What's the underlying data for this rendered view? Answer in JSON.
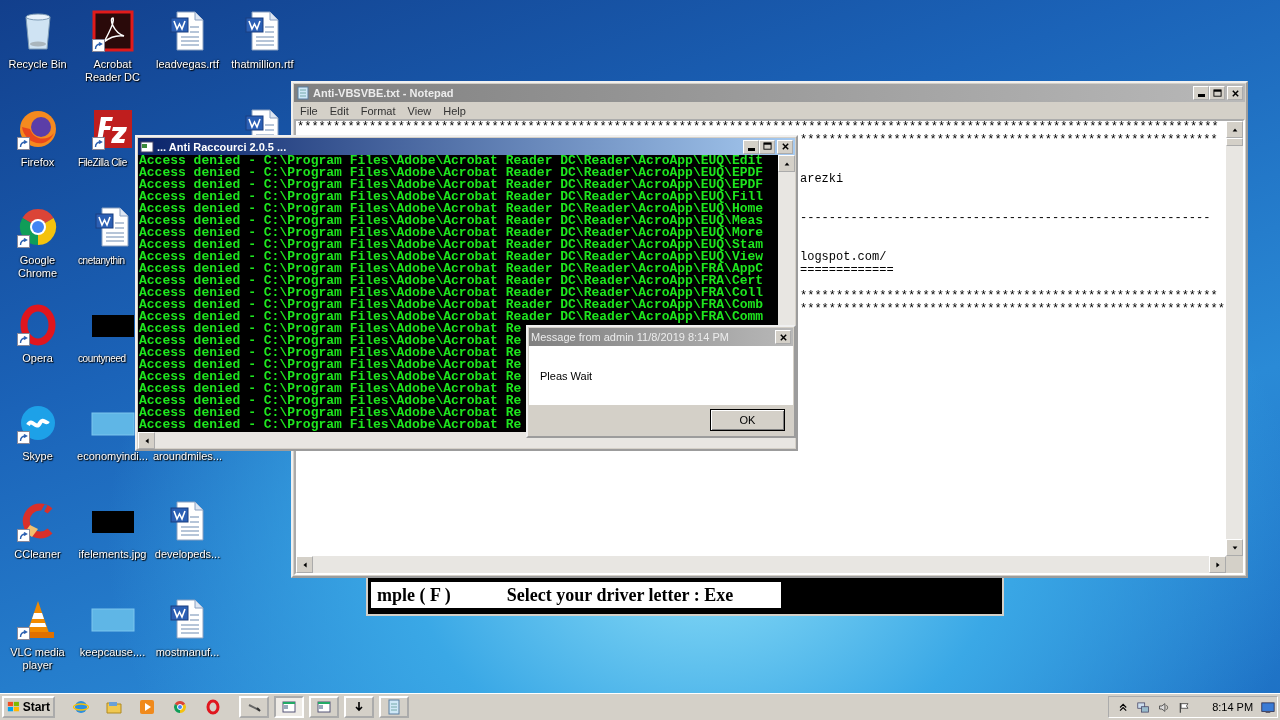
{
  "desktop_icons": [
    {
      "label": "Recycle Bin",
      "kind": "recycle"
    },
    {
      "label": "Firefox",
      "kind": "firefox"
    },
    {
      "label": "Google Chrome",
      "kind": "chrome"
    },
    {
      "label": "Opera",
      "kind": "opera"
    },
    {
      "label": "Skype",
      "kind": "skype"
    },
    {
      "label": "CCleaner",
      "kind": "ccleaner"
    },
    {
      "label": "VLC media player",
      "kind": "vlc"
    },
    {
      "label": "Acrobat Reader DC",
      "kind": "acrobat"
    },
    {
      "label": "FileZilla Clie",
      "kind": "filezilla"
    },
    {
      "label": "cnetanythin",
      "kind": "word"
    },
    {
      "label": "countyneed",
      "kind": "dark-thumb"
    },
    {
      "label": "economyindi...",
      "kind": "blank-thumb"
    },
    {
      "label": "ifelements.jpg",
      "kind": "dark-thumb"
    },
    {
      "label": "keepcause....",
      "kind": "blank-thumb"
    },
    {
      "label": "leadvegas.rtf",
      "kind": "word"
    },
    {
      "label": "aroundmiles...",
      "kind": "none"
    },
    {
      "label": "developeds...",
      "kind": "word"
    },
    {
      "label": "mostmanuf...",
      "kind": "word"
    },
    {
      "label": "thatmillion.rtf",
      "kind": "word"
    },
    {
      "kind": "word"
    }
  ],
  "notepad": {
    "title": "Anti-VBSVBE.txt - Notepad",
    "menu": [
      "File",
      "Edit",
      "Format",
      "View",
      "Help"
    ],
    "lines": [
      {
        "kind": "full",
        "text": "********************************************************************************************************************************"
      },
      {
        "kind": "partial",
        "text": "**********************************************************"
      },
      {
        "kind": "partial",
        "text": "arezki"
      },
      {
        "kind": "partial",
        "text": "---------------------------------------------------------"
      },
      {
        "kind": "partial",
        "text": "logspot.com/"
      },
      {
        "kind": "partial",
        "text": "============="
      },
      {
        "kind": "partial",
        "text": "**********************************************************"
      },
      {
        "kind": "partial",
        "text": "***********************************************************"
      }
    ]
  },
  "console": {
    "title": "... Anti Raccourci 2.0.5 ...",
    "lines": [
      "Access denied - C:\\Program Files\\Adobe\\Acrobat Reader DC\\Reader\\AcroApp\\EUQ\\Edit",
      "Access denied - C:\\Program Files\\Adobe\\Acrobat Reader DC\\Reader\\AcroApp\\EUQ\\EPDF",
      "Access denied - C:\\Program Files\\Adobe\\Acrobat Reader DC\\Reader\\AcroApp\\EUQ\\EPDF",
      "Access denied - C:\\Program Files\\Adobe\\Acrobat Reader DC\\Reader\\AcroApp\\EUQ\\Fill",
      "Access denied - C:\\Program Files\\Adobe\\Acrobat Reader DC\\Reader\\AcroApp\\EUQ\\Home",
      "Access denied - C:\\Program Files\\Adobe\\Acrobat Reader DC\\Reader\\AcroApp\\EUQ\\Meas",
      "Access denied - C:\\Program Files\\Adobe\\Acrobat Reader DC\\Reader\\AcroApp\\EUQ\\More",
      "Access denied - C:\\Program Files\\Adobe\\Acrobat Reader DC\\Reader\\AcroApp\\EUQ\\Stam",
      "Access denied - C:\\Program Files\\Adobe\\Acrobat Reader DC\\Reader\\AcroApp\\EUQ\\View",
      "Access denied - C:\\Program Files\\Adobe\\Acrobat Reader DC\\Reader\\AcroApp\\FRA\\AppC",
      "Access denied - C:\\Program Files\\Adobe\\Acrobat Reader DC\\Reader\\AcroApp\\FRA\\Cert",
      "Access denied - C:\\Program Files\\Adobe\\Acrobat Reader DC\\Reader\\AcroApp\\FRA\\Coll",
      "Access denied - C:\\Program Files\\Adobe\\Acrobat Reader DC\\Reader\\AcroApp\\FRA\\Comb",
      "Access denied - C:\\Program Files\\Adobe\\Acrobat Reader DC\\Reader\\AcroApp\\FRA\\Comm",
      "Access denied - C:\\Program Files\\Adobe\\Acrobat Re",
      "Access denied - C:\\Program Files\\Adobe\\Acrobat Re",
      "Access denied - C:\\Program Files\\Adobe\\Acrobat Re",
      "Access denied - C:\\Program Files\\Adobe\\Acrobat Re",
      "Access denied - C:\\Program Files\\Adobe\\Acrobat Re",
      "Access denied - C:\\Program Files\\Adobe\\Acrobat Re",
      "Access denied - C:\\Program Files\\Adobe\\Acrobat Re",
      "Access denied - C:\\Program Files\\Adobe\\Acrobat Re",
      "Access denied - C:\\Program Files\\Adobe\\Acrobat Re"
    ]
  },
  "message_box": {
    "title": "Message from admin 11/8/2019 8:14 PM",
    "message": "Pleas Wait",
    "button": "OK"
  },
  "driver_window": {
    "texts": [
      "mple ( F )",
      "Select your driver letter : Exe"
    ]
  },
  "taskbar": {
    "start": "Start",
    "quick_launch": [
      {
        "kind": "ie"
      },
      {
        "kind": "folder"
      },
      {
        "kind": "media"
      },
      {
        "kind": "chrome"
      },
      {
        "kind": "opera"
      }
    ],
    "tasks": [
      {
        "kind": "tool",
        "selected": false
      },
      {
        "kind": "window",
        "selected": true
      },
      {
        "kind": "window",
        "selected": false
      },
      {
        "kind": "arrow",
        "selected": false
      },
      {
        "kind": "notepad",
        "selected": false
      }
    ],
    "tray": [
      {
        "kind": "chevron"
      },
      {
        "kind": "network"
      },
      {
        "kind": "volume"
      },
      {
        "kind": "flag"
      }
    ],
    "clock": "8:14 PM"
  }
}
